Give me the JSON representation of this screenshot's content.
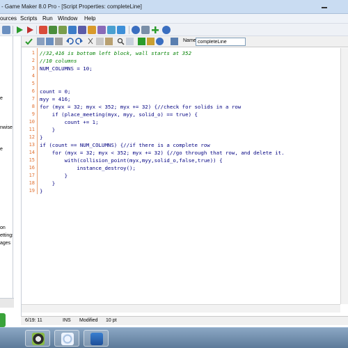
{
  "window": {
    "title": "- Game Maker 8.0 Pro - [Script Properties: completeLine]"
  },
  "menu": {
    "items": [
      "ources",
      "Scripts",
      "Run",
      "Window",
      "Help"
    ]
  },
  "left_panel": {
    "fragments": [
      "e",
      "nwise",
      "e",
      "on",
      "ettings",
      "ages"
    ]
  },
  "editor": {
    "name_label": "Name:",
    "name_value": "completeLine",
    "line_numbers": [
      "1",
      "2",
      "3",
      "4",
      "5",
      "6",
      "7",
      "8",
      "9",
      "10",
      "11",
      "12",
      "13",
      "14",
      "15",
      "16",
      "17",
      "18",
      "19"
    ],
    "lines": [
      "//32,416 is bottom left block, wall starts at 352",
      "//10 columns",
      "NUM_COLUMNS = 10;",
      "",
      "",
      "count = 0;",
      "myy = 416;",
      "for (myx = 32; myx < 352; myx += 32) {//check for solids in a row",
      "    if (place_meeting(myx, myy, solid_o) == true) {",
      "        count += 1;",
      "    }",
      "}",
      "if (count == NUM_COLUMNS) {//if there is a complete row",
      "    for (myx = 32; myx < 352; myx += 32) {//go through that row, and delete it.",
      "        with(collision_point(myx,myy,solid_o,false,true)) {",
      "            instance_destroy();",
      "        }",
      "    }",
      "}"
    ]
  },
  "status": {
    "position": "6/19: 11",
    "mode": "INS",
    "state": "Modified",
    "font_size": "10 pt"
  },
  "colors": {
    "code_keyword": "#000080",
    "code_comment": "#008000",
    "line_number": "#e07030",
    "title_bar": "#c9dcf2"
  }
}
